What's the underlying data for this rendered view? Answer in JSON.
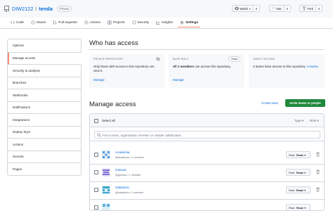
{
  "repo": {
    "owner": "DIW2122",
    "separator": "/",
    "name": "tenda",
    "visibility": "Private"
  },
  "actions": {
    "watch": {
      "label": "Watch",
      "count": "0"
    },
    "star": {
      "label": "Star",
      "count": "0"
    },
    "fork": {
      "label": "Fork",
      "count": "0"
    }
  },
  "tabs": [
    {
      "label": "Code",
      "icon": "code-icon"
    },
    {
      "label": "Issues",
      "icon": "issue-icon"
    },
    {
      "label": "Pull requests",
      "icon": "pull-request-icon"
    },
    {
      "label": "Actions",
      "icon": "play-icon"
    },
    {
      "label": "Projects",
      "icon": "table-icon"
    },
    {
      "label": "Security",
      "icon": "shield-icon"
    },
    {
      "label": "Insights",
      "icon": "graph-icon"
    },
    {
      "label": "Settings",
      "icon": "gear-icon",
      "active": true
    }
  ],
  "sidebar": {
    "items": [
      {
        "label": "Options"
      },
      {
        "label": "Manage access",
        "active": true
      },
      {
        "label": "Security & analysis"
      },
      {
        "label": "Branches"
      },
      {
        "label": "Webhooks"
      },
      {
        "label": "Notifications"
      },
      {
        "label": "Integrations"
      },
      {
        "label": "Deploy keys"
      },
      {
        "label": "Actions"
      },
      {
        "label": "Secrets"
      },
      {
        "label": "Pages"
      }
    ]
  },
  "access": {
    "title": "Who has access",
    "private": {
      "label": "PRIVATE REPOSITORY",
      "text": "Only those with access to this repository can view it.",
      "link": "Manage"
    },
    "base_role": {
      "label": "BASE ROLE",
      "badge": "Read",
      "count": "All 1 members",
      "text_after": " can access this repository.",
      "link": "Manage"
    },
    "direct": {
      "label": "DIRECT ACCESS",
      "count": "4 teams",
      "text_middle": " have access to this repository. ",
      "link_inline": "4 teams",
      "text_end": "."
    }
  },
  "manage": {
    "title": "Manage access",
    "create_team": "Create team",
    "invite": "Invite teams or people",
    "select_all": "Select all",
    "type_filter": "Type",
    "role_filter": "Role",
    "search_placeholder": "Find a team, organization member or outside collaborator...",
    "rows": [
      {
        "name": "Academia",
        "meta": "@academia • 1 member",
        "role_label": "Role:",
        "role": "Read",
        "avatar_color": "#5a9bd5"
      },
      {
        "name": "Gimnas",
        "meta": "@gimnas • 1 member",
        "role_label": "Role:",
        "role": "Read",
        "avatar_color": "#7c6fd6"
      },
      {
        "name": "Sabateria",
        "meta": "@sabateria • 1 member",
        "role_label": "Role:",
        "role": "Read",
        "avatar_color": "#3aa7c9"
      },
      {
        "name": "",
        "meta": "",
        "role_label": "Role:",
        "role": "Read",
        "avatar_color": "#5fb0d8"
      }
    ]
  },
  "colors": {
    "accent_link": "#0969da",
    "active_tab_underline": "#fd8c73",
    "primary_button": "#1f883d",
    "border": "#d0d7de"
  }
}
